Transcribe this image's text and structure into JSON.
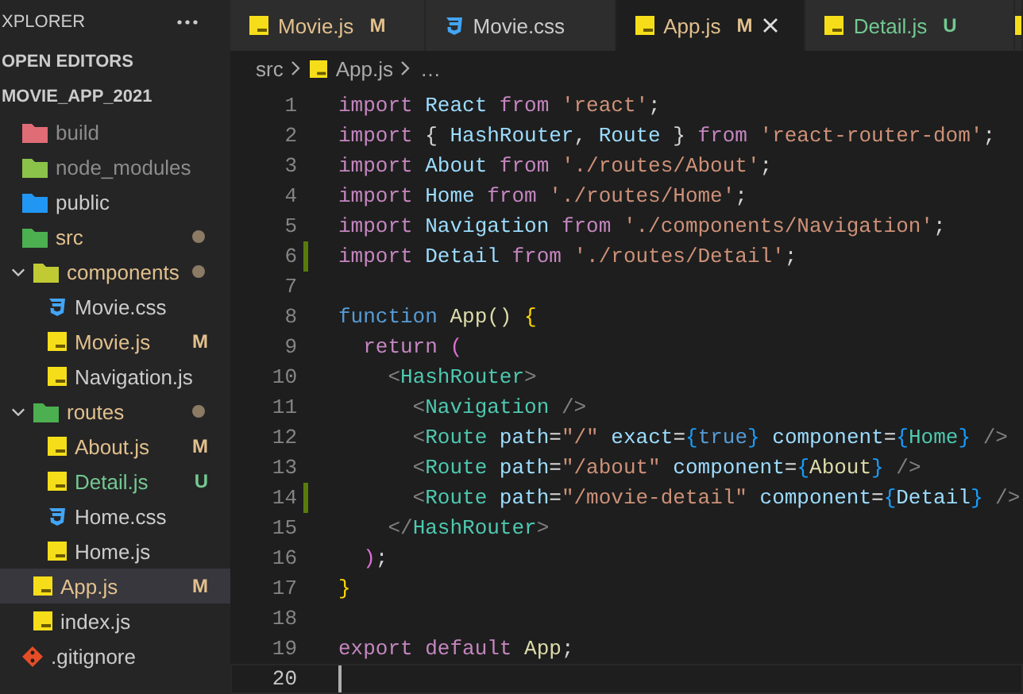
{
  "sidebar": {
    "title": "XPLORER",
    "section": "OPEN EDITORS",
    "project": "MOVIE_APP_2021",
    "tree": [
      {
        "name": "build",
        "kind": "folder",
        "color": "#e06c75",
        "ignored": true,
        "modified": false,
        "untracked": false,
        "selected": false
      },
      {
        "name": "node_modules",
        "kind": "folder",
        "color": "#8bc34a",
        "ignored": true,
        "modified": false,
        "untracked": false,
        "selected": false
      },
      {
        "name": "public",
        "kind": "folder",
        "color": "#2196f3",
        "ignored": false,
        "modified": false,
        "untracked": false,
        "selected": false
      },
      {
        "name": "src",
        "kind": "folder",
        "color": "#4caf50",
        "ignored": false,
        "modified": true,
        "untracked": false,
        "selected": false,
        "children": [
          {
            "name": "components",
            "kind": "folder",
            "color": "#c0ca33",
            "expanded": true,
            "ignored": false,
            "modified": true,
            "untracked": false,
            "selected": false,
            "children": [
              {
                "name": "Movie.css",
                "kind": "css",
                "ignored": false,
                "modified": false,
                "untracked": false,
                "selected": false
              },
              {
                "name": "Movie.js",
                "kind": "js",
                "ignored": false,
                "modified": true,
                "untracked": false,
                "badge": "M",
                "selected": false
              },
              {
                "name": "Navigation.js",
                "kind": "js",
                "ignored": false,
                "modified": false,
                "untracked": false,
                "selected": false
              }
            ]
          },
          {
            "name": "routes",
            "kind": "folder",
            "color": "#4caf50",
            "expanded": true,
            "ignored": false,
            "modified": true,
            "untracked": false,
            "selected": false,
            "children": [
              {
                "name": "About.js",
                "kind": "js",
                "ignored": false,
                "modified": true,
                "untracked": false,
                "badge": "M",
                "selected": false
              },
              {
                "name": "Detail.js",
                "kind": "js",
                "ignored": false,
                "modified": false,
                "untracked": true,
                "badge": "U",
                "selected": false
              },
              {
                "name": "Home.css",
                "kind": "css",
                "ignored": false,
                "modified": false,
                "untracked": false,
                "selected": false
              },
              {
                "name": "Home.js",
                "kind": "js",
                "ignored": false,
                "modified": false,
                "untracked": false,
                "selected": false
              }
            ]
          },
          {
            "name": "App.js",
            "kind": "js",
            "ignored": false,
            "modified": true,
            "untracked": false,
            "badge": "M",
            "selected": true
          },
          {
            "name": "index.js",
            "kind": "js",
            "ignored": false,
            "modified": false,
            "untracked": false,
            "selected": false
          }
        ]
      },
      {
        "name": ".gitignore",
        "kind": "git",
        "ignored": false,
        "modified": false,
        "untracked": false,
        "selected": false
      }
    ]
  },
  "tabs": [
    {
      "label": "Movie.js",
      "kind": "js",
      "modified": true,
      "untracked": false,
      "badge": "M",
      "selected": false
    },
    {
      "label": "Movie.css",
      "kind": "css",
      "modified": false,
      "untracked": false,
      "selected": false
    },
    {
      "label": "App.js",
      "kind": "js",
      "modified": true,
      "untracked": false,
      "badge": "M",
      "selected": true
    },
    {
      "label": "Detail.js",
      "kind": "js",
      "modified": false,
      "untracked": true,
      "badge": "U",
      "selected": false
    }
  ],
  "breadcrumbs": [
    {
      "label": "src",
      "kind": "folder"
    },
    {
      "label": "App.js",
      "kind": "js"
    },
    {
      "label": "…",
      "kind": "more"
    }
  ],
  "editor": {
    "lines": [
      {
        "number": "1",
        "current": false,
        "tokens": [
          {
            "t": "import ",
            "kind": "kw"
          },
          {
            "t": "React ",
            "kind": "id"
          },
          {
            "t": "from ",
            "kind": "kw"
          },
          {
            "t": "'react'",
            "kind": "str"
          },
          {
            "t": ";",
            "kind": "p"
          }
        ]
      },
      {
        "number": "2",
        "current": false,
        "tokens": [
          {
            "t": "import ",
            "kind": "kw"
          },
          {
            "t": "{ ",
            "kind": "p"
          },
          {
            "t": "HashRouter",
            "kind": "id"
          },
          {
            "t": ", ",
            "kind": "p"
          },
          {
            "t": "Route ",
            "kind": "id"
          },
          {
            "t": "} ",
            "kind": "p"
          },
          {
            "t": "from ",
            "kind": "kw"
          },
          {
            "t": "'react-router-dom'",
            "kind": "str"
          },
          {
            "t": ";",
            "kind": "p"
          }
        ]
      },
      {
        "number": "3",
        "current": false,
        "tokens": [
          {
            "t": "import ",
            "kind": "kw"
          },
          {
            "t": "About ",
            "kind": "id"
          },
          {
            "t": "from ",
            "kind": "kw"
          },
          {
            "t": "'./routes/About'",
            "kind": "str"
          },
          {
            "t": ";",
            "kind": "p"
          }
        ]
      },
      {
        "number": "4",
        "current": false,
        "tokens": [
          {
            "t": "import ",
            "kind": "kw"
          },
          {
            "t": "Home ",
            "kind": "id"
          },
          {
            "t": "from ",
            "kind": "kw"
          },
          {
            "t": "'./routes/Home'",
            "kind": "str"
          },
          {
            "t": ";",
            "kind": "p"
          }
        ]
      },
      {
        "number": "5",
        "current": false,
        "tokens": [
          {
            "t": "import ",
            "kind": "kw"
          },
          {
            "t": "Navigation ",
            "kind": "id"
          },
          {
            "t": "from ",
            "kind": "kw"
          },
          {
            "t": "'./components/Navigation'",
            "kind": "str"
          },
          {
            "t": ";",
            "kind": "p"
          }
        ]
      },
      {
        "number": "6",
        "added": true,
        "current": false,
        "tokens": [
          {
            "t": "import ",
            "kind": "kw"
          },
          {
            "t": "Detail ",
            "kind": "id"
          },
          {
            "t": "from ",
            "kind": "kw"
          },
          {
            "t": "'./routes/Detail'",
            "kind": "str"
          },
          {
            "t": ";",
            "kind": "p"
          }
        ]
      },
      {
        "number": "7",
        "current": false
      },
      {
        "number": "8",
        "current": false,
        "tokens": [
          {
            "t": "function ",
            "kind": "decl"
          },
          {
            "t": "App",
            "kind": "fn"
          },
          {
            "t": "() ",
            "kind": "fn"
          },
          {
            "t": "{",
            "kind": "b1"
          }
        ]
      },
      {
        "number": "9",
        "current": false,
        "tokens": [
          {
            "t": "  return ",
            "kind": "kw"
          },
          {
            "t": "(",
            "kind": "b2"
          }
        ]
      },
      {
        "number": "10",
        "current": false,
        "tokens": [
          {
            "t": "    <",
            "kind": "ang"
          },
          {
            "t": "HashRouter",
            "kind": "tag"
          },
          {
            "t": ">",
            "kind": "ang"
          }
        ]
      },
      {
        "number": "11",
        "current": false,
        "tokens": [
          {
            "t": "      <",
            "kind": "ang"
          },
          {
            "t": "Navigation ",
            "kind": "tag"
          },
          {
            "t": "/>",
            "kind": "ang"
          }
        ]
      },
      {
        "number": "12",
        "current": false,
        "tokens": [
          {
            "t": "      <",
            "kind": "ang"
          },
          {
            "t": "Route ",
            "kind": "tag"
          },
          {
            "t": "path",
            "kind": "id"
          },
          {
            "t": "=",
            "kind": "p"
          },
          {
            "t": "\"/\" ",
            "kind": "str"
          },
          {
            "t": "exact",
            "kind": "id"
          },
          {
            "t": "=",
            "kind": "p"
          },
          {
            "t": "{",
            "kind": "b3"
          },
          {
            "t": "true",
            "kind": "decl"
          },
          {
            "t": "} ",
            "kind": "b3"
          },
          {
            "t": "component",
            "kind": "id"
          },
          {
            "t": "=",
            "kind": "p"
          },
          {
            "t": "{",
            "kind": "b3"
          },
          {
            "t": "Home",
            "kind": "tag"
          },
          {
            "t": "} ",
            "kind": "b3"
          },
          {
            "t": "/>",
            "kind": "ang"
          }
        ]
      },
      {
        "number": "13",
        "current": false,
        "tokens": [
          {
            "t": "      <",
            "kind": "ang"
          },
          {
            "t": "Route ",
            "kind": "tag"
          },
          {
            "t": "path",
            "kind": "id"
          },
          {
            "t": "=",
            "kind": "p"
          },
          {
            "t": "\"/about\" ",
            "kind": "str"
          },
          {
            "t": "component",
            "kind": "id"
          },
          {
            "t": "=",
            "kind": "p"
          },
          {
            "t": "{",
            "kind": "b3"
          },
          {
            "t": "About",
            "kind": "fn"
          },
          {
            "t": "} ",
            "kind": "b3"
          },
          {
            "t": "/>",
            "kind": "ang"
          }
        ]
      },
      {
        "number": "14",
        "added": true,
        "current": false,
        "tokens": [
          {
            "t": "      <",
            "kind": "ang"
          },
          {
            "t": "Route ",
            "kind": "tag"
          },
          {
            "t": "path",
            "kind": "id"
          },
          {
            "t": "=",
            "kind": "p"
          },
          {
            "t": "\"/movie-detail\" ",
            "kind": "str"
          },
          {
            "t": "component",
            "kind": "id"
          },
          {
            "t": "=",
            "kind": "p"
          },
          {
            "t": "{",
            "kind": "b3"
          },
          {
            "t": "Detail",
            "kind": "id"
          },
          {
            "t": "} ",
            "kind": "b3"
          },
          {
            "t": "/>",
            "kind": "ang"
          }
        ]
      },
      {
        "number": "15",
        "current": false,
        "tokens": [
          {
            "t": "    </",
            "kind": "ang"
          },
          {
            "t": "HashRouter",
            "kind": "tag"
          },
          {
            "t": ">",
            "kind": "ang"
          }
        ]
      },
      {
        "number": "16",
        "current": false,
        "tokens": [
          {
            "t": "  )",
            "kind": "b2"
          },
          {
            "t": ";",
            "kind": "p"
          }
        ]
      },
      {
        "number": "17",
        "current": false,
        "tokens": [
          {
            "t": "}",
            "kind": "b1"
          }
        ]
      },
      {
        "number": "18",
        "current": false
      },
      {
        "number": "19",
        "current": false,
        "tokens": [
          {
            "t": "export ",
            "kind": "kw"
          },
          {
            "t": "default ",
            "kind": "kw"
          },
          {
            "t": "App",
            "kind": "fn"
          },
          {
            "t": ";",
            "kind": "p"
          }
        ]
      },
      {
        "number": "20",
        "current": true
      }
    ]
  }
}
